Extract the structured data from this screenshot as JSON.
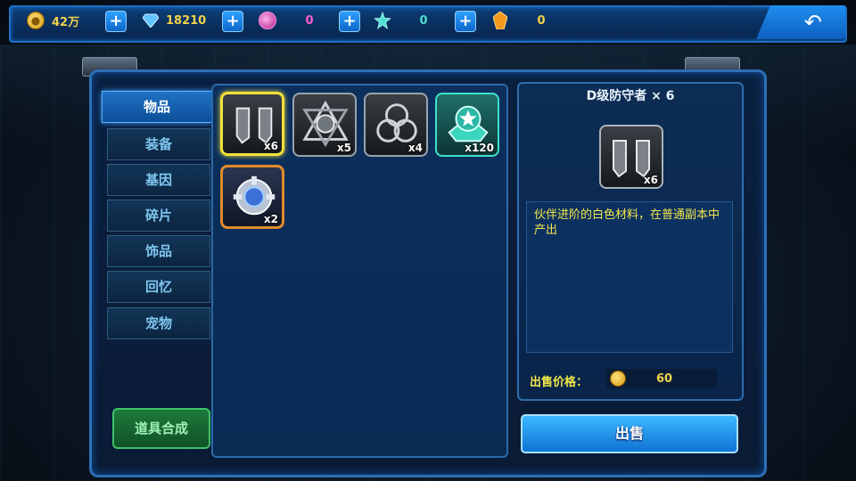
{
  "resources": [
    {
      "icon": "gold-coin-icon",
      "value": "42万",
      "color": "#f1d24a"
    },
    {
      "icon": "diamond-icon",
      "value": "18210",
      "color": "#f1d24a"
    },
    {
      "icon": "pink-orb-icon",
      "value": "0",
      "color": "#ff5fd0"
    },
    {
      "icon": "star-crystal-icon",
      "value": "0",
      "color": "#4ee0d0"
    },
    {
      "icon": "orange-gem-icon",
      "value": "0",
      "color": "#f1d24a"
    }
  ],
  "tabs": [
    {
      "label": "物品",
      "active": true
    },
    {
      "label": "装备",
      "active": false
    },
    {
      "label": "基因",
      "active": false
    },
    {
      "label": "碎片",
      "active": false
    },
    {
      "label": "饰品",
      "active": false
    },
    {
      "label": "回忆",
      "active": false
    },
    {
      "label": "宠物",
      "active": false
    }
  ],
  "synth_button": "道具合成",
  "items": [
    {
      "icon": "d-defender-material-icon",
      "qty": "x6",
      "selected": true,
      "style": "gray"
    },
    {
      "icon": "star-gear-material-icon",
      "qty": "x5",
      "selected": false,
      "style": "gray"
    },
    {
      "icon": "triple-ring-material-icon",
      "qty": "x4",
      "selected": false,
      "style": "gray"
    },
    {
      "icon": "star-badge-icon",
      "qty": "x120",
      "selected": false,
      "style": "teal"
    },
    {
      "icon": "gear-core-icon",
      "qty": "x2",
      "selected": false,
      "style": "orange"
    }
  ],
  "detail": {
    "title": "D级防守者 × 6",
    "icon": "d-defender-material-icon",
    "icon_qty": "x6",
    "description": "伙伴进阶的白色材料，在普通副本中产出",
    "price_label": "出售价格：",
    "price_value": "60"
  },
  "sell_button": "出售",
  "colors": {
    "accent": "#1e72c4",
    "gold": "#f1d24a",
    "select": "#f0e03a"
  }
}
